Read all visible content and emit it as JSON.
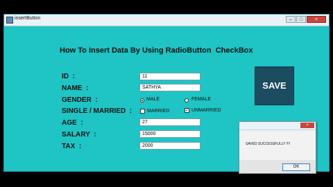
{
  "window": {
    "title": "insertButton",
    "controls": {
      "minimize": "–",
      "maximize": "□",
      "close": "×"
    }
  },
  "heading": "How To Insert Data By Using RadioButton  CheckBox",
  "form": {
    "labels": {
      "id": "ID  :",
      "name": "NAME  :",
      "gender": "GENDER  :",
      "marital": "SINGLE / MARRIED  :",
      "age": "AGE  :",
      "salary": "SALARY  :",
      "tax": "TAX  :"
    },
    "values": {
      "id": "11",
      "name": "SATHYA",
      "age": "27",
      "salary": "15000",
      "tax": "2000"
    },
    "gender_options": [
      {
        "label": "MALE",
        "selected": true
      },
      {
        "label": "FEMALE",
        "selected": false
      }
    ],
    "marital_options": [
      {
        "label": "MARRIED",
        "checked": false
      },
      {
        "label": "UNMARRIED",
        "checked": true
      }
    ]
  },
  "save_button": "SAVE",
  "message_box": {
    "close": "×",
    "text": "SAVED SUCCESSFULLY !!!!",
    "ok": "OK"
  },
  "colors": {
    "form_background": "#1fc4c4",
    "save_button": "#1b4c5f",
    "close_button": "#c9463d"
  }
}
